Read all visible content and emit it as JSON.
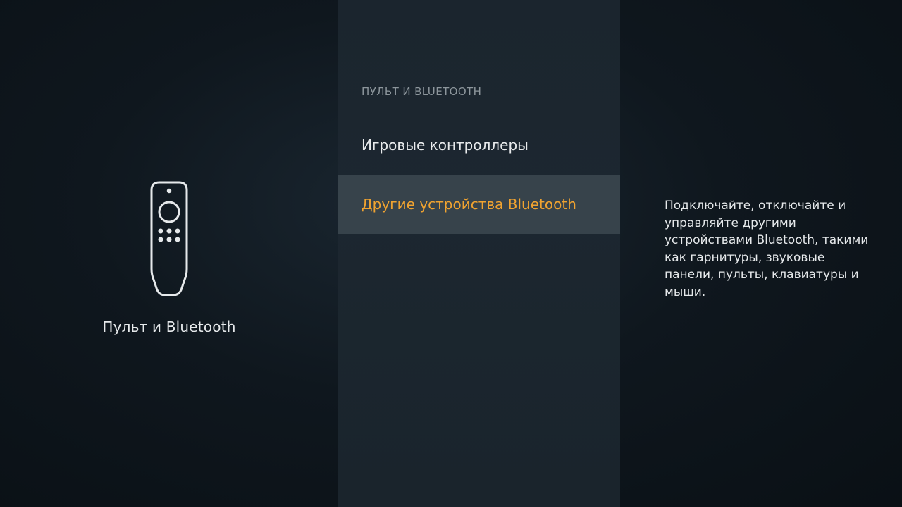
{
  "left_panel": {
    "icon": "remote-control-icon",
    "title": "Пульт и Bluetooth"
  },
  "menu": {
    "header": "ПУЛЬТ И BLUETOOTH",
    "items": [
      {
        "label": "Игровые контроллеры",
        "selected": false
      },
      {
        "label": "Другие устройства Bluetooth",
        "selected": true
      }
    ]
  },
  "description": {
    "text": "Подключайте, отключайте и управляйте другими устройствами Bluetooth, такими как гарнитуры, звуковые панели, пульты, клавиатуры и мыши."
  },
  "colors": {
    "highlight_text": "#f0a330",
    "selected_row_bg": "#37434b",
    "menu_panel_bg": "#1c2730",
    "background": "#0b1217"
  }
}
